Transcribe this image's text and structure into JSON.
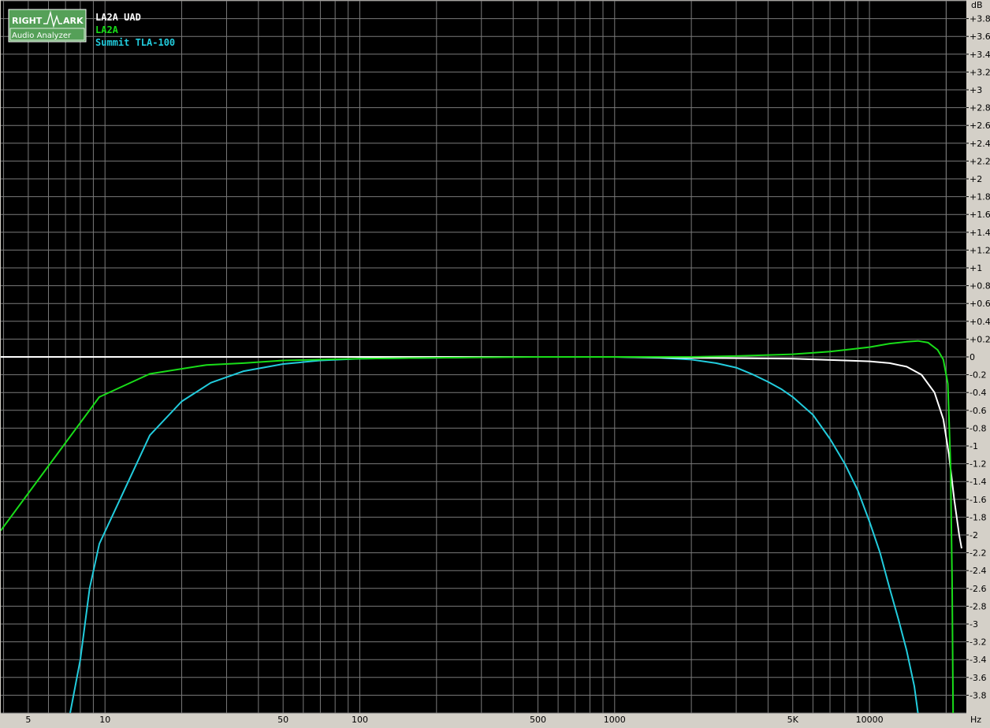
{
  "logo": {
    "word1": "RIGHT",
    "word2": "ARK",
    "subtitle": "Audio Analyzer"
  },
  "colors": {
    "background": "#000000",
    "grid": "#7a7a7a",
    "frame": "#d4d0c8",
    "logo_bg": "#55a058"
  },
  "chart_data": {
    "type": "line",
    "title": "",
    "xlabel": "Hz",
    "ylabel": "dB",
    "xscale": "log",
    "xlim": [
      3.9,
      24000
    ],
    "ylim": [
      -4,
      4
    ],
    "grid": true,
    "legend_position": "top-left",
    "x_tick_labels": [
      {
        "value": 5,
        "label": "5"
      },
      {
        "value": 10,
        "label": "10"
      },
      {
        "value": 50,
        "label": "50"
      },
      {
        "value": 100,
        "label": "100"
      },
      {
        "value": 500,
        "label": "500"
      },
      {
        "value": 1000,
        "label": "1000"
      },
      {
        "value": 5000,
        "label": "5K"
      },
      {
        "value": 10000,
        "label": "10000"
      }
    ],
    "y_tick_labels": [
      {
        "value": 3.8,
        "label": "+3.8"
      },
      {
        "value": 3.6,
        "label": "+3.6"
      },
      {
        "value": 3.4,
        "label": "+3.4"
      },
      {
        "value": 3.2,
        "label": "+3.2"
      },
      {
        "value": 3.0,
        "label": "+3"
      },
      {
        "value": 2.8,
        "label": "+2.8"
      },
      {
        "value": 2.6,
        "label": "+2.6"
      },
      {
        "value": 2.4,
        "label": "+2.4"
      },
      {
        "value": 2.2,
        "label": "+2.2"
      },
      {
        "value": 2.0,
        "label": "+2"
      },
      {
        "value": 1.8,
        "label": "+1.8"
      },
      {
        "value": 1.6,
        "label": "+1.6"
      },
      {
        "value": 1.4,
        "label": "+1.4"
      },
      {
        "value": 1.2,
        "label": "+1.2"
      },
      {
        "value": 1.0,
        "label": "+1"
      },
      {
        "value": 0.8,
        "label": "+0.8"
      },
      {
        "value": 0.6,
        "label": "+0.6"
      },
      {
        "value": 0.4,
        "label": "+0.4"
      },
      {
        "value": 0.2,
        "label": "+0.2"
      },
      {
        "value": 0.0,
        "label": "0"
      },
      {
        "value": -0.2,
        "label": "-0.2"
      },
      {
        "value": -0.4,
        "label": "-0.4"
      },
      {
        "value": -0.6,
        "label": "-0.6"
      },
      {
        "value": -0.8,
        "label": "-0.8"
      },
      {
        "value": -1.0,
        "label": "-1"
      },
      {
        "value": -1.2,
        "label": "-1.2"
      },
      {
        "value": -1.4,
        "label": "-1.4"
      },
      {
        "value": -1.6,
        "label": "-1.6"
      },
      {
        "value": -1.8,
        "label": "-1.8"
      },
      {
        "value": -2.0,
        "label": "-2"
      },
      {
        "value": -2.2,
        "label": "-2.2"
      },
      {
        "value": -2.4,
        "label": "-2.4"
      },
      {
        "value": -2.6,
        "label": "-2.6"
      },
      {
        "value": -2.8,
        "label": "-2.8"
      },
      {
        "value": -3.0,
        "label": "-3"
      },
      {
        "value": -3.2,
        "label": "-3.2"
      },
      {
        "value": -3.4,
        "label": "-3.4"
      },
      {
        "value": -3.6,
        "label": "-3.6"
      },
      {
        "value": -3.8,
        "label": "-3.8"
      }
    ],
    "series": [
      {
        "name": "LA2A UAD",
        "color": "#ffffff",
        "x": [
          3.9,
          10,
          50,
          100,
          1000,
          2000,
          5000,
          8000,
          10000,
          12000,
          14000,
          16000,
          18000,
          19500,
          20500,
          21500,
          22500,
          23000
        ],
        "y": [
          0.0,
          0.0,
          0.0,
          0.0,
          0.0,
          -0.01,
          -0.02,
          -0.04,
          -0.05,
          -0.07,
          -0.11,
          -0.2,
          -0.4,
          -0.7,
          -1.1,
          -1.6,
          -2.0,
          -2.15
        ]
      },
      {
        "name": "LA2A",
        "color": "#19dd19",
        "x": [
          3.9,
          9.5,
          15,
          25,
          35,
          50,
          70,
          100,
          200,
          500,
          1000,
          2000,
          3000,
          5000,
          7000,
          10000,
          12000,
          14000,
          15500,
          17000,
          18500,
          19500,
          20300,
          20800,
          21100,
          21300
        ],
        "y": [
          -1.95,
          -0.45,
          -0.19,
          -0.09,
          -0.07,
          -0.04,
          -0.03,
          -0.02,
          -0.01,
          0.0,
          0.0,
          0.0,
          0.01,
          0.03,
          0.06,
          0.11,
          0.15,
          0.17,
          0.18,
          0.16,
          0.08,
          -0.03,
          -0.3,
          -1.2,
          -2.5,
          -4.0
        ]
      },
      {
        "name": "Summit TLA-100",
        "color": "#22ccdd",
        "x": [
          7.3,
          8,
          8.7,
          9.5,
          15,
          20,
          26,
          35,
          50,
          70,
          100,
          200,
          350,
          500,
          1000,
          1500,
          2000,
          2500,
          3000,
          3500,
          4000,
          4500,
          5000,
          6000,
          7000,
          8000,
          9000,
          10000,
          11000,
          12000,
          13000,
          14000,
          15000,
          15500
        ],
        "y": [
          -4.0,
          -3.4,
          -2.6,
          -2.1,
          -0.88,
          -0.5,
          -0.29,
          -0.16,
          -0.08,
          -0.04,
          -0.02,
          -0.01,
          0.0,
          0.0,
          0.0,
          -0.01,
          -0.03,
          -0.07,
          -0.12,
          -0.2,
          -0.28,
          -0.36,
          -0.45,
          -0.65,
          -0.92,
          -1.2,
          -1.5,
          -1.85,
          -2.2,
          -2.6,
          -2.95,
          -3.3,
          -3.7,
          -4.0
        ]
      }
    ]
  }
}
